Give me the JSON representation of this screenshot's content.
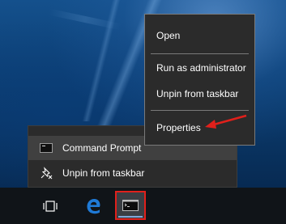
{
  "context_menu": {
    "items": [
      {
        "label": "Open"
      },
      {
        "label": "Run as administrator"
      },
      {
        "label": "Unpin from taskbar"
      },
      {
        "label": "Properties"
      }
    ]
  },
  "jump_list": {
    "pinned_item": {
      "label": "Command Prompt",
      "icon": "command-prompt-icon"
    },
    "unpin_item": {
      "label": "Unpin from taskbar",
      "icon": "unpin-icon"
    }
  },
  "taskbar": {
    "buttons": [
      {
        "icon": "task-view-icon"
      },
      {
        "icon": "edge-icon"
      },
      {
        "icon": "command-prompt-icon",
        "highlighted": true
      }
    ]
  },
  "colors": {
    "menu_bg": "#2b2b2b",
    "menu_hover": "#404040",
    "annotation_red": "#e0201b",
    "taskbar_bg": "#101418",
    "edge_blue": "#1f7ad6"
  }
}
